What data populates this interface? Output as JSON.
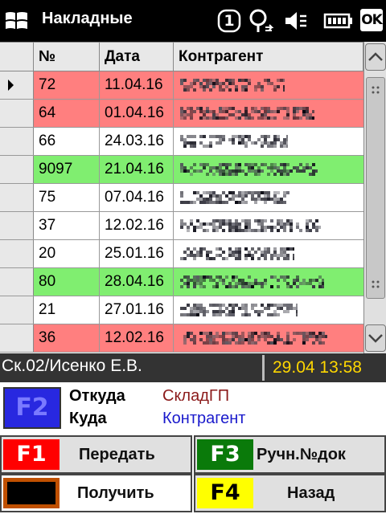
{
  "app": {
    "title": "Накладные",
    "tray_icons": [
      "windows-logo-icon",
      "number-one-icon",
      "connectivity-icon",
      "speaker-muted-icon",
      "battery-icon",
      "ok-button"
    ],
    "ok_label": "OK",
    "tray_number": "1"
  },
  "grid": {
    "columns": [
      "",
      "№",
      "Дата",
      "Контрагент"
    ],
    "selected_row_index": 0,
    "rows": [
      {
        "num": "72",
        "date": "11.04.16",
        "contractor": "(redacted)",
        "color": "#ff7f7f"
      },
      {
        "num": "64",
        "date": "01.04.16",
        "contractor": "(redacted)",
        "color": "#ff7f7f"
      },
      {
        "num": "66",
        "date": "24.03.16",
        "contractor": "(redacted)",
        "color": "#ffffff"
      },
      {
        "num": "9097",
        "date": "21.04.16",
        "contractor": "(redacted)",
        "color": "#80ee70"
      },
      {
        "num": "75",
        "date": "07.04.16",
        "contractor": "(redacted)",
        "color": "#ffffff"
      },
      {
        "num": "37",
        "date": "12.02.16",
        "contractor": "(redacted)",
        "color": "#ffffff"
      },
      {
        "num": "20",
        "date": "25.01.16",
        "contractor": "(redacted)",
        "color": "#ffffff"
      },
      {
        "num": "80",
        "date": "28.04.16",
        "contractor": "(redacted)",
        "color": "#80ee70"
      },
      {
        "num": "21",
        "date": "27.01.16",
        "contractor": "(redacted)",
        "color": "#ffffff"
      },
      {
        "num": "36",
        "date": "12.02.16",
        "contractor": "(redacted)",
        "color": "#ff7f7f"
      }
    ]
  },
  "status": {
    "user": "Ск.02/Исенко Е.В.",
    "datetime": "29.04 13:58"
  },
  "route": {
    "key": "F2",
    "from_label": "Откуда",
    "from_value": "СкладГП",
    "to_label": "Куда",
    "to_value": "Контрагент",
    "from_color": "#8b1a1a",
    "to_color": "#1a1acc"
  },
  "buttons": {
    "f1": {
      "key": "F1",
      "label": "Передать",
      "key_bg": "#ff0000",
      "key_fg": "#ffffff"
    },
    "f3": {
      "key": "F3",
      "label": "Ручн.№док",
      "key_bg": "#0a7a0a",
      "key_fg": "#ffffff"
    },
    "receive": {
      "key": "",
      "label": "Получить",
      "key_bg": "#c05000",
      "key_fg": "#000000"
    },
    "f4": {
      "key": "F4",
      "label": "Назад",
      "key_bg": "#ffff00",
      "key_fg": "#000000"
    }
  }
}
